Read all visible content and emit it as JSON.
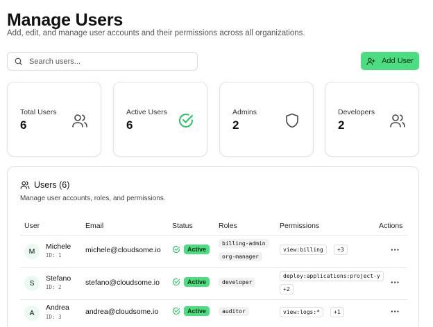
{
  "header": {
    "title": "Manage Users",
    "subtitle": "Add, edit, and manage user accounts and their permissions across all organizations."
  },
  "search": {
    "placeholder": "Search users...",
    "value": ""
  },
  "actions": {
    "add_user_label": "Add User"
  },
  "stats": [
    {
      "label": "Total Users",
      "value": "6",
      "icon": "users-icon"
    },
    {
      "label": "Active Users",
      "value": "6",
      "icon": "check-circle-icon"
    },
    {
      "label": "Admins",
      "value": "2",
      "icon": "shield-icon"
    },
    {
      "label": "Developers",
      "value": "2",
      "icon": "users-icon"
    }
  ],
  "users_panel": {
    "title": "Users (6)",
    "description": "Manage user accounts, roles, and permissions.",
    "columns": [
      "User",
      "Email",
      "Status",
      "Roles",
      "Permissions",
      "Actions"
    ],
    "rows": [
      {
        "initial": "M",
        "name": "Michele",
        "id": "ID: 1",
        "email": "michele@cloudsome.io",
        "status": "Active",
        "roles": [
          "billing-admin",
          "org-manager"
        ],
        "permissions": [
          "view:billing",
          "+3"
        ]
      },
      {
        "initial": "S",
        "name": "Stefano",
        "id": "ID: 2",
        "email": "stefano@cloudsome.io",
        "status": "Active",
        "roles": [
          "developer"
        ],
        "permissions": [
          "deploy:applications:project-y",
          "+2"
        ]
      },
      {
        "initial": "A",
        "name": "Andrea",
        "id": "ID: 3",
        "email": "andrea@cloudsome.io",
        "status": "Active",
        "roles": [
          "auditor"
        ],
        "permissions": [
          "view:logs:*",
          "+1"
        ]
      }
    ],
    "actions_glyph": "···"
  },
  "colors": {
    "accent": "#4ade80",
    "border": "#e2e2e2",
    "avatar_bg": "#eafaf0"
  }
}
